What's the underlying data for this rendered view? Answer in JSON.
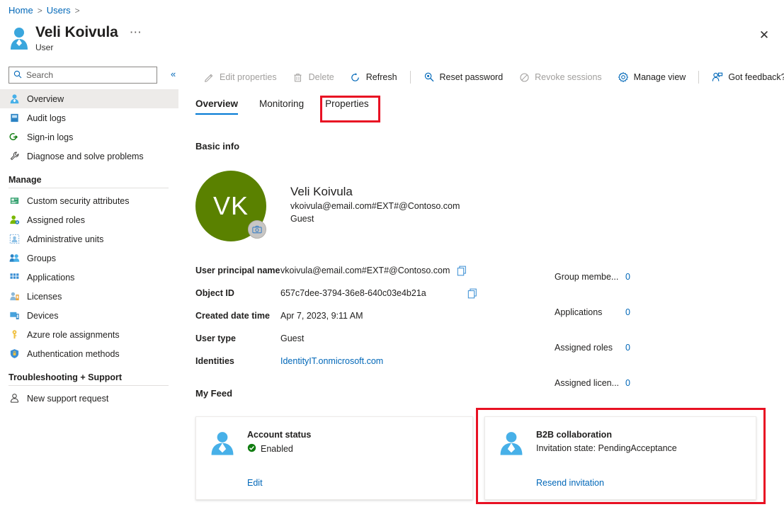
{
  "breadcrumb": {
    "items": [
      "Home",
      "Users"
    ],
    "separator": ">"
  },
  "header": {
    "title": "Veli Koivula",
    "subtitle": "User",
    "more_label": "⋯",
    "close_label": "✕",
    "avatar_icon": "user-icon"
  },
  "sidebar": {
    "search": {
      "placeholder": "Search",
      "value": "",
      "icon": "search-icon"
    },
    "collapse_label": "«",
    "items": [
      {
        "label": "Overview",
        "icon": "user-icon",
        "selected": true
      },
      {
        "label": "Audit logs",
        "icon": "book-icon",
        "selected": false
      },
      {
        "label": "Sign-in logs",
        "icon": "signin-arrow-icon",
        "selected": false
      },
      {
        "label": "Diagnose and solve problems",
        "icon": "wrench-icon",
        "selected": false
      }
    ],
    "sections": [
      {
        "title": "Manage",
        "items": [
          {
            "label": "Custom security attributes",
            "icon": "attribute-card-icon"
          },
          {
            "label": "Assigned roles",
            "icon": "person-gear-icon"
          },
          {
            "label": "Administrative units",
            "icon": "admin-unit-icon"
          },
          {
            "label": "Groups",
            "icon": "people-icon"
          },
          {
            "label": "Applications",
            "icon": "grid-apps-icon"
          },
          {
            "label": "Licenses",
            "icon": "license-icon"
          },
          {
            "label": "Devices",
            "icon": "device-icon"
          },
          {
            "label": "Azure role assignments",
            "icon": "key-icon"
          },
          {
            "label": "Authentication methods",
            "icon": "shield-icon"
          }
        ]
      },
      {
        "title": "Troubleshooting + Support",
        "items": [
          {
            "label": "New support request",
            "icon": "support-person-icon"
          }
        ]
      }
    ]
  },
  "commandbar": {
    "buttons": [
      {
        "label": "Edit properties",
        "icon": "pencil-icon",
        "disabled": true
      },
      {
        "label": "Delete",
        "icon": "trash-icon",
        "disabled": true
      },
      {
        "label": "Refresh",
        "icon": "refresh-icon",
        "disabled": false
      },
      {
        "label": "Reset password",
        "icon": "key-lookup-icon",
        "disabled": false
      },
      {
        "label": "Revoke sessions",
        "icon": "block-icon",
        "disabled": true
      },
      {
        "label": "Manage view",
        "icon": "gear-icon",
        "disabled": false
      },
      {
        "label": "Got feedback?",
        "icon": "feedback-person-icon",
        "disabled": false
      }
    ]
  },
  "tabs": [
    {
      "label": "Overview",
      "active": true,
      "highlighted": false
    },
    {
      "label": "Monitoring",
      "active": false,
      "highlighted": false
    },
    {
      "label": "Properties",
      "active": false,
      "highlighted": true
    }
  ],
  "basic_info": {
    "section_title": "Basic info",
    "avatar_initials": "VK",
    "avatar_color": "#5a8100",
    "camera_icon": "camera-icon",
    "name": "Veli Koivula",
    "upn": "vkoivula@email.com#EXT#@Contoso.com",
    "user_type": "Guest",
    "details": [
      {
        "label": "User principal name",
        "value": "vkoivula@email.com#EXT#@Contoso.com",
        "copy": true,
        "link": false
      },
      {
        "label": "Object ID",
        "value": "657c7dee-3794-36e8-640c03e4b21a",
        "copy": true,
        "link": false
      },
      {
        "label": "Created date time",
        "value": "Apr 7, 2023, 9:11 AM",
        "copy": false,
        "link": false
      },
      {
        "label": "User type",
        "value": "Guest",
        "copy": false,
        "link": false
      },
      {
        "label": "Identities",
        "value": "IdentityIT.onmicrosoft.com",
        "copy": false,
        "link": true
      }
    ],
    "stats": [
      {
        "label": "Group membe...",
        "value": "0"
      },
      {
        "label": "Applications",
        "value": "0"
      },
      {
        "label": "Assigned roles",
        "value": "0"
      },
      {
        "label": "Assigned licen...",
        "value": "0"
      }
    ]
  },
  "my_feed": {
    "section_title": "My Feed",
    "cards": [
      {
        "title": "Account status",
        "icon": "user-avatar-icon",
        "status_text": "Enabled",
        "status_icon": "check-circle-icon",
        "status_color": "#107c10",
        "subtitle": "",
        "link": "Edit",
        "highlighted": false
      },
      {
        "title": "B2B collaboration",
        "icon": "user-avatar-icon",
        "status_text": "",
        "status_icon": "",
        "status_color": "",
        "subtitle": "Invitation state: PendingAcceptance",
        "link": "Resend invitation",
        "highlighted": true
      }
    ]
  },
  "colors": {
    "accent": "#0078d4",
    "link": "#0067b8",
    "highlight": "#e81123",
    "selected_bg": "#edebe9",
    "avatar_green": "#5a8100",
    "success_green": "#107c10"
  }
}
